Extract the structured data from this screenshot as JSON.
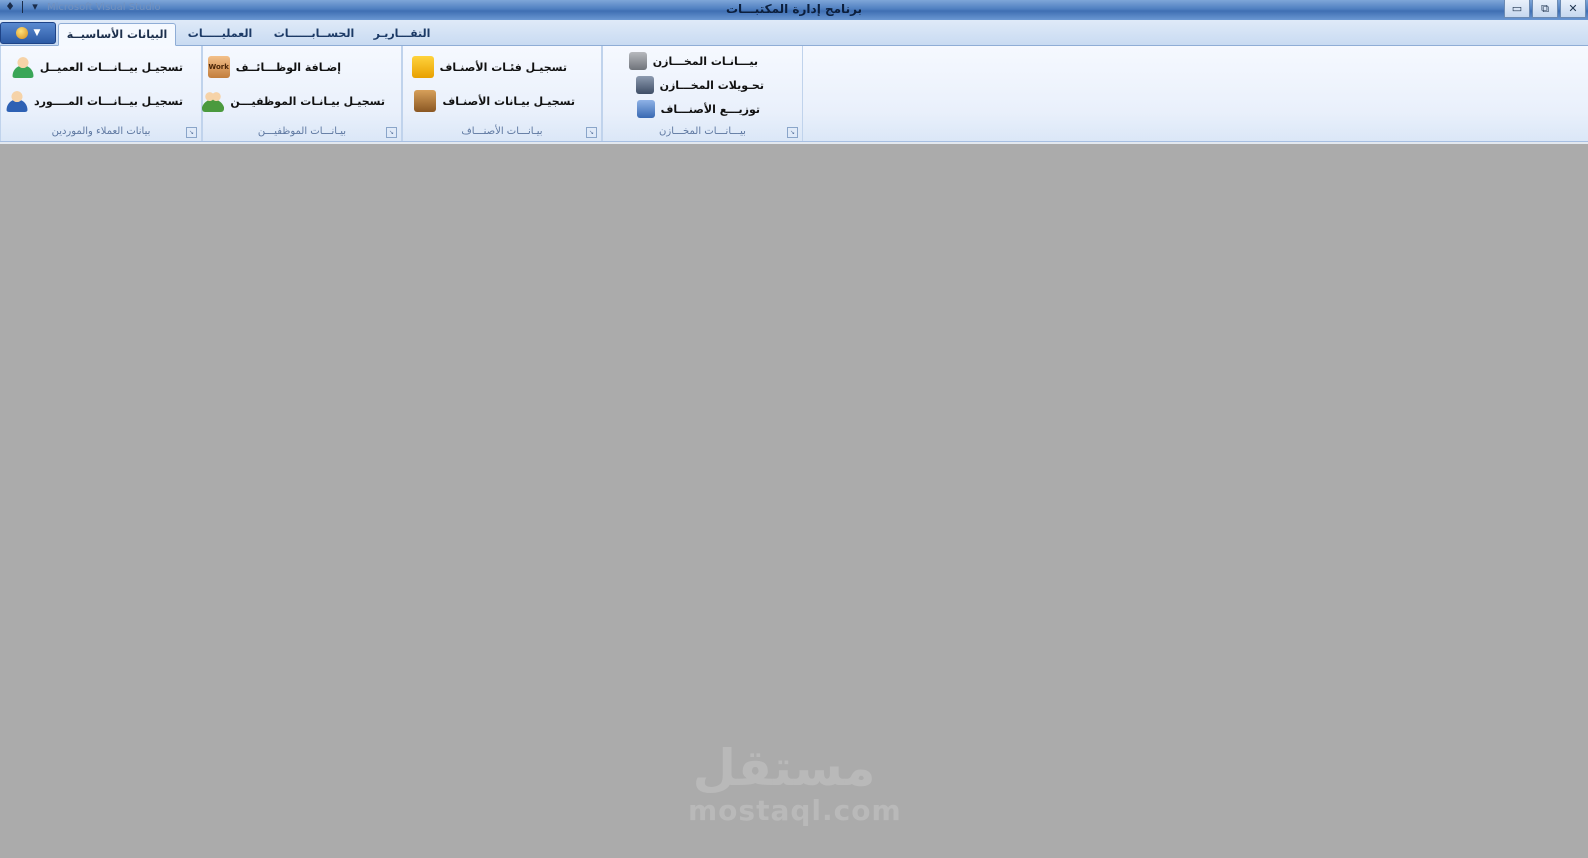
{
  "window": {
    "title": "برنامج إدارة المكتبـــات",
    "controls": {
      "minimize": "▭",
      "restore": "⧉",
      "close": "✕"
    }
  },
  "quick_access": {
    "menu_icon": "▾",
    "ghost_title": "Microsoft Visual Studio"
  },
  "tabs": [
    {
      "label": "البيانات الأساسيــة",
      "active": true
    },
    {
      "label": "العمليـــــات",
      "active": false
    },
    {
      "label": "الحســابــــــات",
      "active": false
    },
    {
      "label": "التقـــاريـر",
      "active": false
    }
  ],
  "groups": {
    "stores": {
      "caption": "بيـــانـــات المخـــازن",
      "items": [
        {
          "label": "بيـــانـات المخـــازن",
          "icon": "warehouse-icon"
        },
        {
          "label": "تحـويلات المخـــازن",
          "icon": "transfer-icon"
        },
        {
          "label": "توزيـــع الأصنـــاف",
          "icon": "distribution-icon"
        }
      ]
    },
    "items": {
      "caption": "بيـانـــات الأصنـــاف",
      "items": [
        {
          "label": "تسجيـل فئـات الأصنـاف",
          "icon": "shopping-bag-icon"
        },
        {
          "label": "تسجيـل بيـانات الأصنـاف",
          "icon": "box-icon"
        }
      ]
    },
    "employees": {
      "caption": "بيـانـــات الموظفيـــن",
      "items": [
        {
          "label": "إضـافة الوظـــائــف",
          "icon": "work-badge-icon"
        },
        {
          "label": "تسجيـل بيـانـات الموظفيـــن",
          "icon": "users-add-icon"
        }
      ]
    },
    "customers": {
      "caption": "بيانات العملاء والموردين",
      "items": [
        {
          "label": "تسجيـل بيــانـــات العميــل",
          "icon": "customer-icon"
        },
        {
          "label": "تسجيـل بيــانـــات المــــورد",
          "icon": "supplier-icon"
        }
      ]
    }
  },
  "watermark": {
    "arabic": "مستقل",
    "latin": "mostaql.com"
  }
}
